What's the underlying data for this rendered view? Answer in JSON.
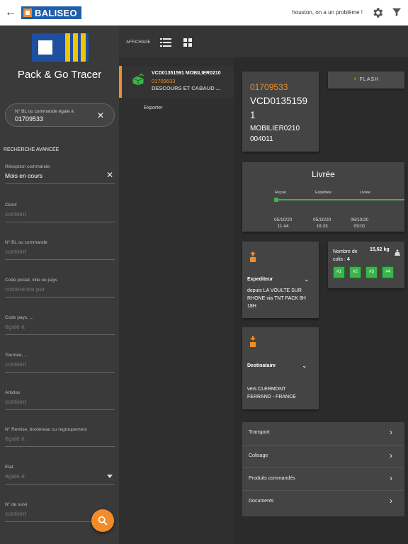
{
  "topbar": {
    "brand": "BALISEO",
    "message": "houston, on a un problème !"
  },
  "sidebar": {
    "app_title": "Pack & Go Tracer",
    "search": {
      "label": "N° BL ou commande égale à",
      "value": "01709533"
    },
    "advanced_label": "RECHERCHE AVANCÉE",
    "fields": [
      {
        "label": "Réception commande",
        "value": "Mois en cours"
      },
      {
        "label": "Client",
        "placeholder": "contient"
      },
      {
        "label": "N° BL ou commande",
        "placeholder": "contient"
      },
      {
        "label": "Code postal, ville ou pays",
        "placeholder": "commence par"
      },
      {
        "label": "Code pays, ...",
        "placeholder": "égale à"
      },
      {
        "label": "Tournée, ...",
        "placeholder": "contient"
      },
      {
        "label": "Articles",
        "placeholder": "contient"
      },
      {
        "label": "N° Remise, bordereau ou regroupement",
        "placeholder": "égale à"
      },
      {
        "label": "Etat",
        "placeholder": "égale à"
      },
      {
        "label": "N° de suivi",
        "placeholder": "contient"
      }
    ]
  },
  "toolbar": {
    "affichage": "AFFICHAGE"
  },
  "list": {
    "item": {
      "title": "VCD01351591 MOBILIER0210",
      "number": "01709533",
      "subtitle": "DESCOURS ET CABAUD ..."
    },
    "export": "Exporter"
  },
  "detail": {
    "order_number": "01709533",
    "ref_line1": "VCD0135159",
    "ref_line2": "1",
    "ref_line3": "MOBILIER0210",
    "ref_line4": "004011",
    "flash": "FLASH",
    "status": "Livrée",
    "timeline": [
      {
        "label": "Reçue",
        "date": "05/10/20",
        "time": "11:44"
      },
      {
        "label": "Expédiée",
        "date": "05/10/20",
        "time": "16:33"
      },
      {
        "label": "Livrée",
        "date": "06/10/20",
        "time": "09:01"
      }
    ],
    "expediteur": {
      "title": "Expediteur",
      "text": "depuis LA VOULTE SUR RHONE via TNT PACK 8H 18H"
    },
    "destinataire": {
      "title": "Destinataire",
      "text": "vers CLERMONT FERRAND - FRANCE"
    },
    "colis": {
      "label": "Nombre de colis : ",
      "count": "4",
      "weight": "15,62 kg",
      "boxes": [
        "#1",
        "#2",
        "#3",
        "#4"
      ]
    },
    "sections": [
      "Transport",
      "Colisage",
      "Produits commandés",
      "Documents"
    ]
  },
  "colors": {
    "accent": "#f28c28",
    "brand_blue": "#1f5fab",
    "status_green": "#3bb54a"
  }
}
